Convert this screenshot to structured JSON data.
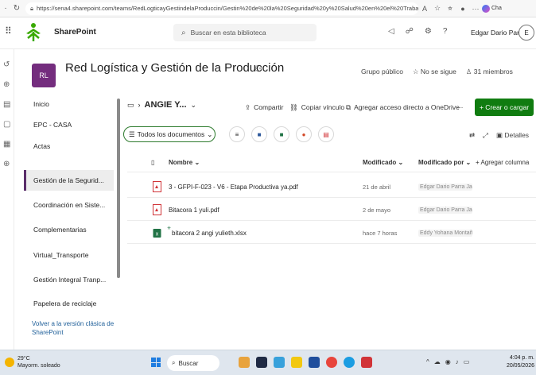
{
  "browser": {
    "url": "https://sena4.sharepoint.com/teams/RedLogticayGestindelaProduccin/Gestin%20de%20la%20Seguridad%20y%20Salud%20en%20el%20Trabajo/Fo...",
    "copilot_label": "Cha"
  },
  "suite": {
    "app_name": "SharePoint",
    "search_placeholder": "Buscar en esta biblioteca",
    "user_name": "Edgar Dario Parra ...",
    "avatar_initial": "E"
  },
  "site": {
    "badge": "RL",
    "title": "Red Logística y Gestión de la Producción",
    "group_label": "Grupo público",
    "follow_label": "No se sigue",
    "members_label": "31 miembros"
  },
  "sidebar": {
    "items": [
      {
        "label": "Inicio"
      },
      {
        "label": "EPC - CASA"
      },
      {
        "label": "Actas"
      },
      {
        "label": "Gestión de la Segurid..."
      },
      {
        "label": "Coordinación en Siste..."
      },
      {
        "label": "Complementarias"
      },
      {
        "label": "Virtual_Transporte"
      },
      {
        "label": "Gestión Integral Tranp..."
      },
      {
        "label": "Papelera de reciclaje"
      }
    ],
    "selected_index": 3,
    "classic_link": "Volver a la versión clásica de SharePoint"
  },
  "command_bar": {
    "folder_name": "ANGIE Y...",
    "share": "Compartir",
    "copy_link": "Copiar vínculo",
    "shortcut": "Agregar acceso directo a OneDrive",
    "more": "···",
    "new_button": "+ Crear o cargar"
  },
  "view_bar": {
    "view_name": "Todos los documentos",
    "details": "Detalles"
  },
  "list": {
    "columns": {
      "name": "Nombre",
      "modified": "Modificado",
      "modified_by": "Modificado por",
      "add_column": "+ Agregar columna"
    },
    "rows": [
      {
        "name": "3 - GFPI-F-023 - V6 - Etapa Productiva ya.pdf",
        "type": "pdf",
        "modified": "21 de abril",
        "modified_by": "Edgar Dario Parra Jair"
      },
      {
        "name": "Bitacora 1 yuli.pdf",
        "type": "pdf",
        "modified": "2 de mayo",
        "modified_by": "Edgar Dario Parra Jair"
      },
      {
        "name": "bitacora 2 angi yulieth.xlsx",
        "type": "xlsx",
        "modified": "hace 7 horas",
        "modified_by": "Eddy Yohana Montañ"
      }
    ]
  },
  "taskbar": {
    "temperature": "29°C",
    "weather": "Mayorm. soleado",
    "search": "Buscar",
    "time": "4:04 p. m.",
    "date": "20/05/2026"
  },
  "colors": {
    "accent_purple": "#742d7e",
    "accent_green": "#107c10"
  }
}
